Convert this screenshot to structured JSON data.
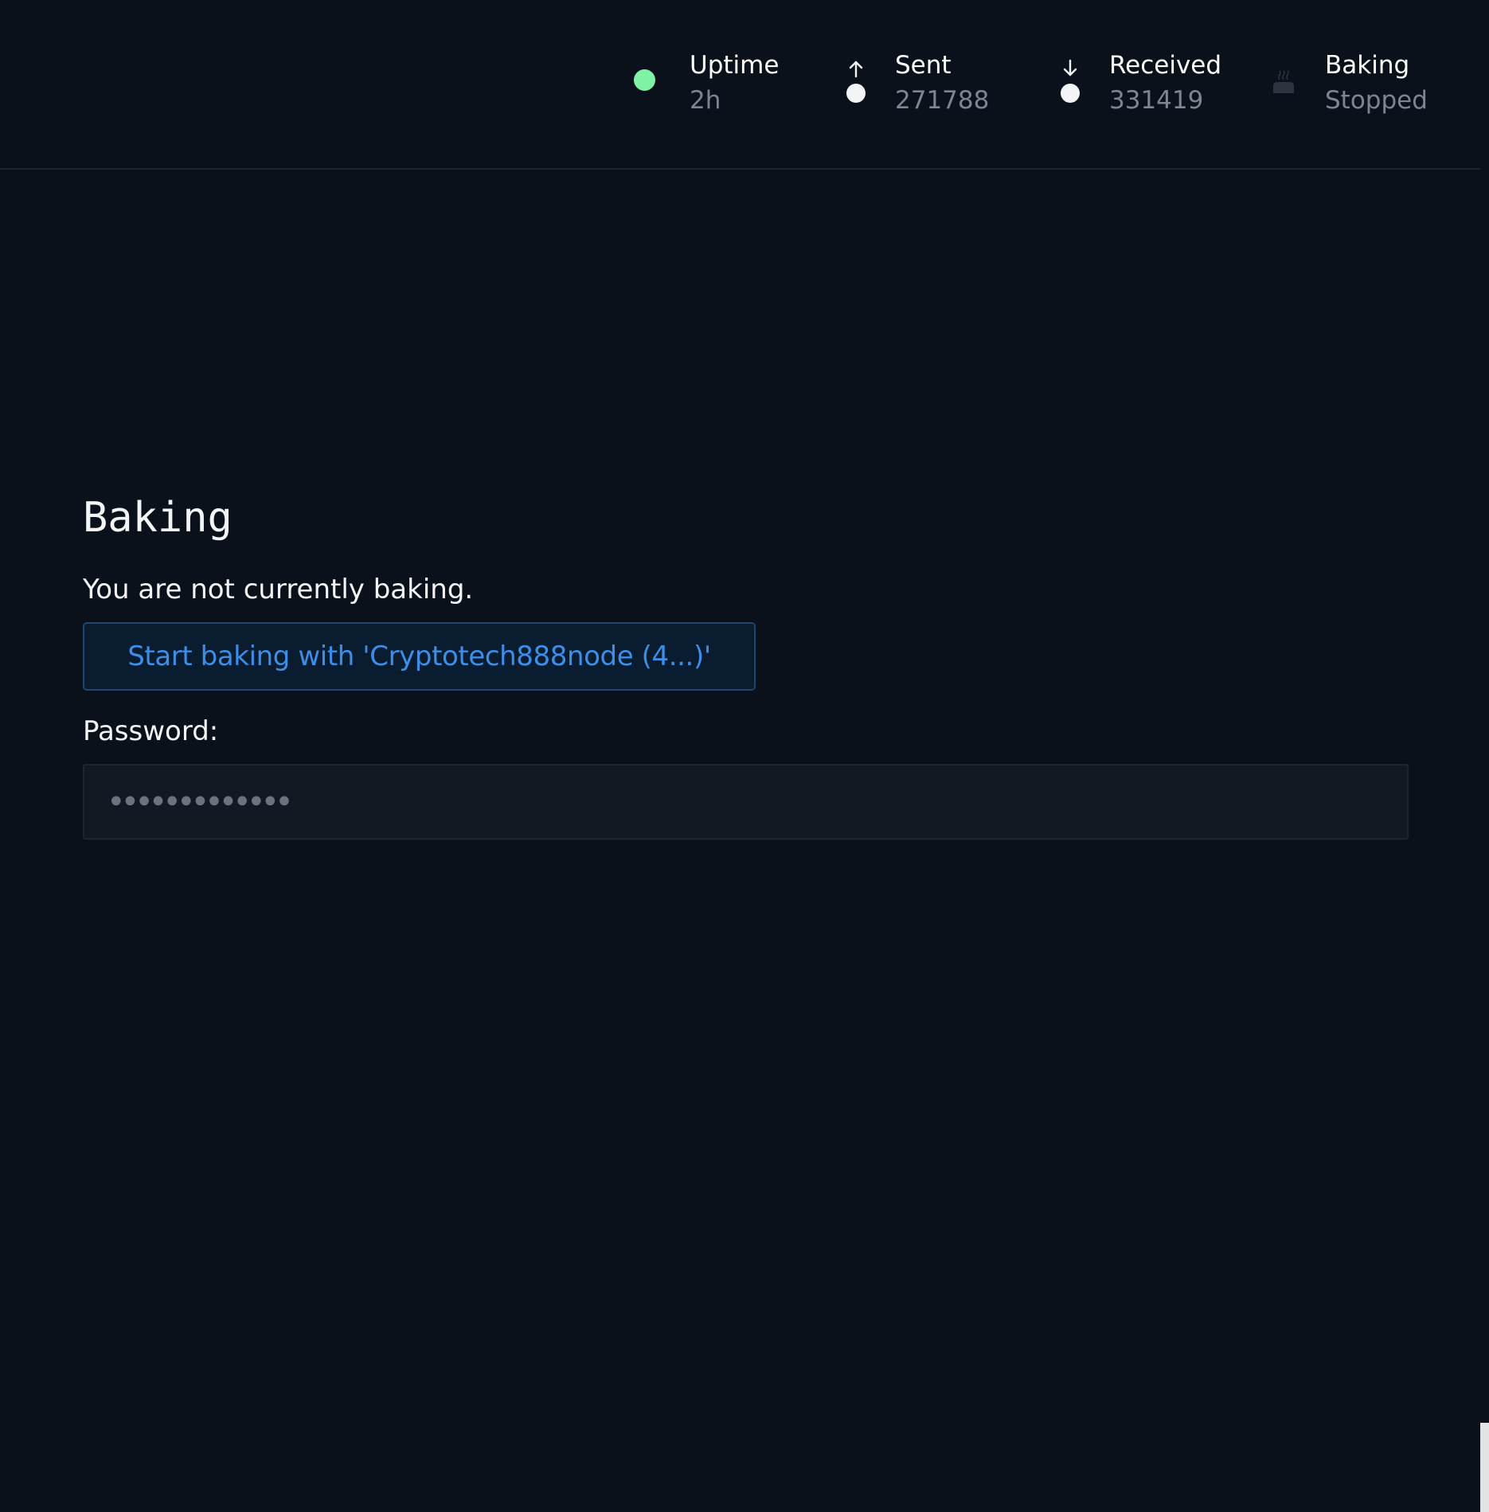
{
  "header": {
    "uptime": {
      "label": "Uptime",
      "value": "2h",
      "icon": "status-dot-icon",
      "color": "#7ff2a4"
    },
    "sent": {
      "label": "Sent",
      "value": "271788",
      "icon": "arrow-up-icon"
    },
    "received": {
      "label": "Received",
      "value": "331419",
      "icon": "arrow-down-icon"
    },
    "baking": {
      "label": "Baking",
      "value": "Stopped",
      "icon": "oven-icon"
    }
  },
  "main": {
    "title": "Baking",
    "status_text": "You are not currently baking.",
    "start_button_label": "Start baking with 'Cryptotech888node (4...)'",
    "password_label": "Password:",
    "password_value": "•••••••••••••"
  },
  "colors": {
    "background": "#0b111a",
    "accent_blue": "#3d8ee8",
    "status_green": "#7ff2a4",
    "muted_text": "#7d8592"
  }
}
